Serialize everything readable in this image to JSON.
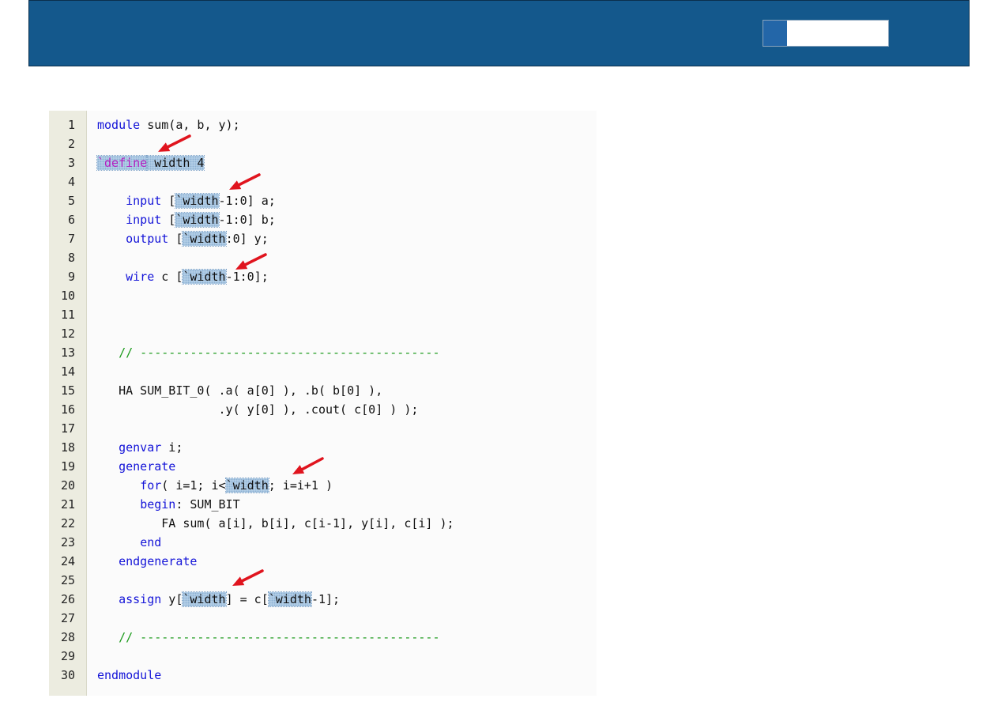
{
  "header": {
    "title": ""
  },
  "editor": {
    "lines": [
      {
        "n": "1",
        "tokens": [
          {
            "t": "kw",
            "v": "module"
          },
          {
            "t": "tx",
            "v": " sum(a, b, y);"
          }
        ]
      },
      {
        "n": "2",
        "tokens": []
      },
      {
        "n": "3",
        "tokens": [
          {
            "t": "pp",
            "v": "`define",
            "hl": true
          },
          {
            "t": "tx",
            "v": " width 4",
            "hl": true
          }
        ]
      },
      {
        "n": "4",
        "tokens": []
      },
      {
        "n": "5",
        "tokens": [
          {
            "t": "tx",
            "v": "    "
          },
          {
            "t": "kw",
            "v": "input"
          },
          {
            "t": "tx",
            "v": " ["
          },
          {
            "t": "tx",
            "v": "`width",
            "hl": true
          },
          {
            "t": "tx",
            "v": "-1:0] a;"
          }
        ]
      },
      {
        "n": "6",
        "tokens": [
          {
            "t": "tx",
            "v": "    "
          },
          {
            "t": "kw",
            "v": "input"
          },
          {
            "t": "tx",
            "v": " ["
          },
          {
            "t": "tx",
            "v": "`width",
            "hl": true
          },
          {
            "t": "tx",
            "v": "-1:0] b;"
          }
        ]
      },
      {
        "n": "7",
        "tokens": [
          {
            "t": "tx",
            "v": "    "
          },
          {
            "t": "kw",
            "v": "output"
          },
          {
            "t": "tx",
            "v": " ["
          },
          {
            "t": "tx",
            "v": "`width",
            "hl": true
          },
          {
            "t": "tx",
            "v": ":0] y;"
          }
        ]
      },
      {
        "n": "8",
        "tokens": []
      },
      {
        "n": "9",
        "tokens": [
          {
            "t": "tx",
            "v": "    "
          },
          {
            "t": "kw",
            "v": "wire"
          },
          {
            "t": "tx",
            "v": " c ["
          },
          {
            "t": "tx",
            "v": "`width",
            "hl": true
          },
          {
            "t": "tx",
            "v": "-1:0];"
          }
        ]
      },
      {
        "n": "10",
        "tokens": []
      },
      {
        "n": "11",
        "tokens": []
      },
      {
        "n": "12",
        "tokens": []
      },
      {
        "n": "13",
        "tokens": [
          {
            "t": "tx",
            "v": "   "
          },
          {
            "t": "cm",
            "v": "// ------------------------------------------"
          }
        ]
      },
      {
        "n": "14",
        "tokens": []
      },
      {
        "n": "15",
        "tokens": [
          {
            "t": "tx",
            "v": "   HA SUM_BIT_0( .a( a[0] ), .b( b[0] ),"
          }
        ]
      },
      {
        "n": "16",
        "tokens": [
          {
            "t": "tx",
            "v": "                 .y( y[0] ), .cout( c[0] ) );"
          }
        ]
      },
      {
        "n": "17",
        "tokens": []
      },
      {
        "n": "18",
        "tokens": [
          {
            "t": "tx",
            "v": "   "
          },
          {
            "t": "kw",
            "v": "genvar"
          },
          {
            "t": "tx",
            "v": " i;"
          }
        ]
      },
      {
        "n": "19",
        "tokens": [
          {
            "t": "tx",
            "v": "   "
          },
          {
            "t": "kw",
            "v": "generate"
          }
        ]
      },
      {
        "n": "20",
        "tokens": [
          {
            "t": "tx",
            "v": "      "
          },
          {
            "t": "kw",
            "v": "for"
          },
          {
            "t": "tx",
            "v": "( i=1; i<"
          },
          {
            "t": "tx",
            "v": "`width",
            "hl": true
          },
          {
            "t": "tx",
            "v": "; i=i+1 )"
          }
        ]
      },
      {
        "n": "21",
        "tokens": [
          {
            "t": "tx",
            "v": "      "
          },
          {
            "t": "kw",
            "v": "begin"
          },
          {
            "t": "tx",
            "v": ": SUM_BIT"
          }
        ]
      },
      {
        "n": "22",
        "tokens": [
          {
            "t": "tx",
            "v": "         FA sum( a[i], b[i], c[i-1], y[i], c[i] );"
          }
        ]
      },
      {
        "n": "23",
        "tokens": [
          {
            "t": "tx",
            "v": "      "
          },
          {
            "t": "kw",
            "v": "end"
          }
        ]
      },
      {
        "n": "24",
        "tokens": [
          {
            "t": "tx",
            "v": "   "
          },
          {
            "t": "kw",
            "v": "endgenerate"
          }
        ]
      },
      {
        "n": "25",
        "tokens": []
      },
      {
        "n": "26",
        "tokens": [
          {
            "t": "tx",
            "v": "   "
          },
          {
            "t": "kw",
            "v": "assign"
          },
          {
            "t": "tx",
            "v": " y["
          },
          {
            "t": "tx",
            "v": "`width",
            "hl": true
          },
          {
            "t": "tx",
            "v": "] = c["
          },
          {
            "t": "tx",
            "v": "`width",
            "hl": true
          },
          {
            "t": "tx",
            "v": "-1];"
          }
        ]
      },
      {
        "n": "27",
        "tokens": []
      },
      {
        "n": "28",
        "tokens": [
          {
            "t": "tx",
            "v": "   "
          },
          {
            "t": "cm",
            "v": "// ------------------------------------------"
          }
        ]
      },
      {
        "n": "29",
        "tokens": []
      },
      {
        "n": "30",
        "tokens": [
          {
            "t": "kw",
            "v": "endmodule"
          }
        ]
      }
    ]
  },
  "colors": {
    "header_bg": "#14588c",
    "keyword": "#1414d8",
    "comment": "#1a9a1a",
    "preprocessor": "#b41ec0",
    "highlight": "#b9d3ea",
    "arrow": "#e0141e"
  }
}
